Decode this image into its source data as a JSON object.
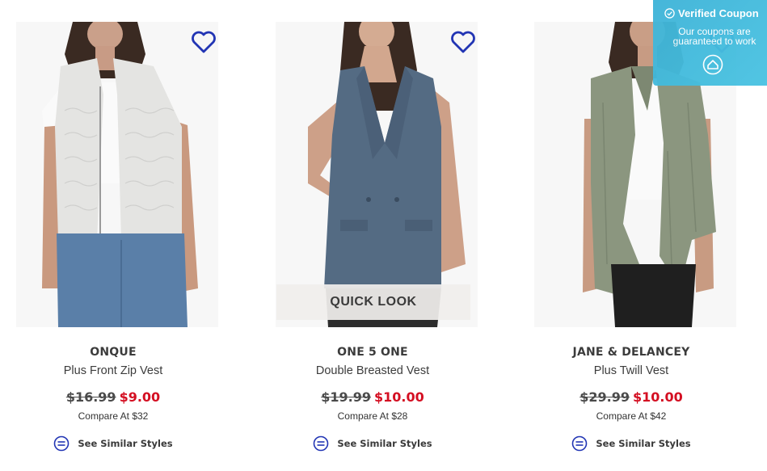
{
  "products": [
    {
      "brand": "ONQUE",
      "name": "Plus Front Zip Vest",
      "old_price": "$16.99",
      "new_price": "$9.00",
      "compare": "Compare At  $32",
      "similar": "See Similar Styles",
      "image_icon": "product-photo-white-knit-vest"
    },
    {
      "brand": "ONE 5 ONE",
      "name": "Double Breasted Vest",
      "old_price": "$19.99",
      "new_price": "$10.00",
      "compare": "Compare At  $28",
      "similar": "See Similar Styles",
      "quick_look": "QUICK LOOK",
      "image_icon": "product-photo-slate-blue-vest"
    },
    {
      "brand": "JANE & DELANCEY",
      "name": "Plus Twill Vest",
      "old_price": "$29.99",
      "new_price": "$10.00",
      "compare": "Compare At  $42",
      "similar": "See Similar Styles",
      "image_icon": "product-photo-olive-drape-vest"
    }
  ],
  "coupon": {
    "title": "Verified Coupon",
    "message": "Our coupons are guaranteed to work"
  },
  "colors": {
    "sale_red": "#d40f22",
    "heart_blue": "#2235b4",
    "coupon_blue": "#45bde0"
  }
}
